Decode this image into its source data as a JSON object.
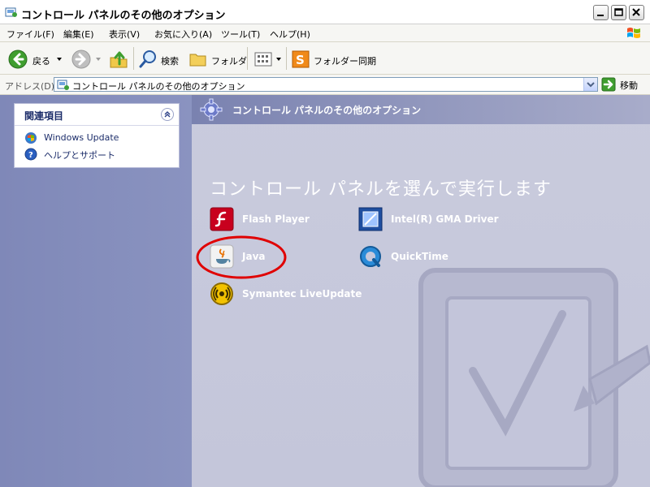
{
  "window": {
    "title": "コントロール パネルのその他のオプション"
  },
  "menu": {
    "items": [
      "ファイル(F)",
      "編集(E)",
      "表示(V)",
      "お気に入り(A)",
      "ツール(T)",
      "ヘルプ(H)"
    ]
  },
  "toolbar": {
    "back_label": "戻る",
    "search_label": "検索",
    "folder_label": "フォルダ",
    "sync_label": "フォルダー同期"
  },
  "address": {
    "label": "アドレス(D)",
    "value": "コントロール パネルのその他のオプション",
    "go_label": "移動"
  },
  "sidebar": {
    "title": "関連項目",
    "links": [
      "Windows Update",
      "ヘルプとサポート"
    ]
  },
  "main": {
    "header": "コントロール パネルのその他のオプション",
    "title": "コントロール パネルを選んで実行します",
    "items": [
      "Flash Player",
      "Intel(R) GMA Driver",
      "Java",
      "QuickTime",
      "Symantec LiveUpdate"
    ]
  },
  "colors": {
    "sidebar_bg": "#8a93c0",
    "main_bg": "#c6c8dc",
    "highlight_ring": "#e00000"
  }
}
